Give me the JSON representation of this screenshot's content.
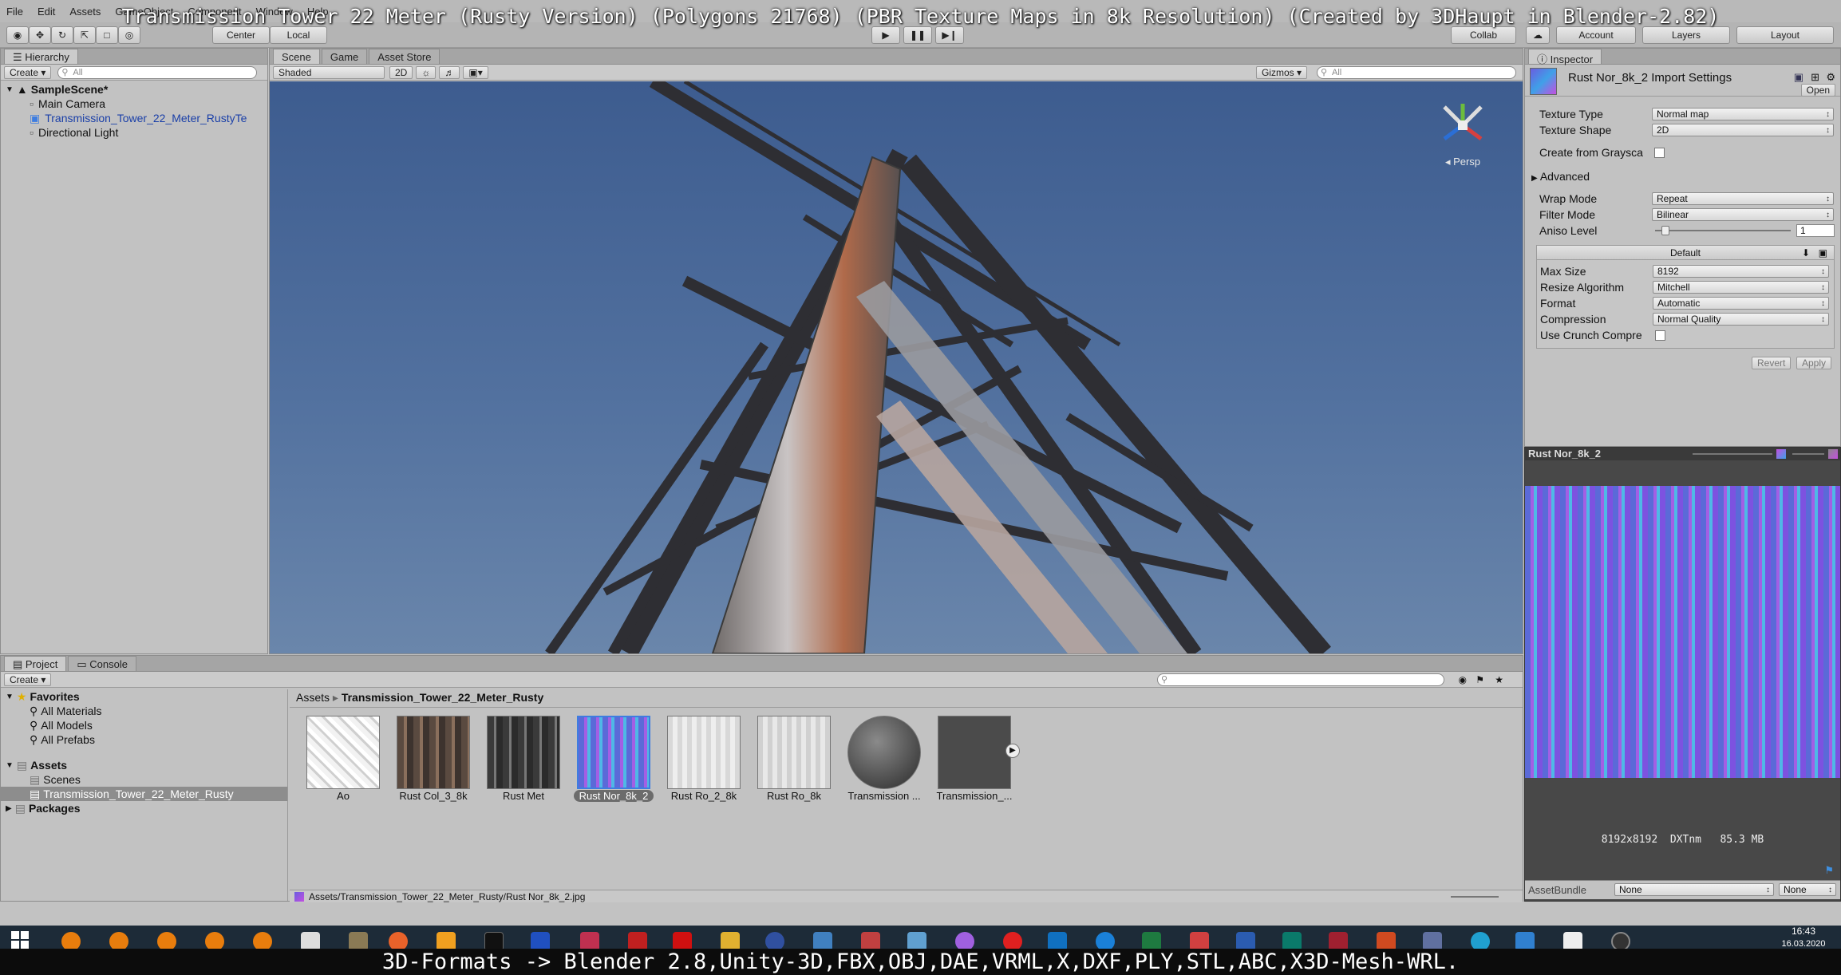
{
  "overlay_title": "Transmission Tower 22 Meter (Rusty Version) (Polygons 21768) (PBR Texture Maps in 8k Resolution) (Created by 3DHaupt in Blender-2.82)",
  "menu": [
    "File",
    "Edit",
    "Assets",
    "GameObject",
    "Component",
    "Window",
    "Help"
  ],
  "toolbar": {
    "center_label": "Center",
    "local_label": "Local",
    "collab_label": "Collab",
    "account_label": "Account",
    "layers_label": "Layers",
    "layout_label": "Layout"
  },
  "hierarchy": {
    "tab": "Hierarchy",
    "create": "Create",
    "search_placeholder": "All",
    "scene": "SampleScene*",
    "items": [
      "Main Camera",
      "Transmission_Tower_22_Meter_RustyTe",
      "Directional Light"
    ]
  },
  "scene_view": {
    "tabs": [
      "Scene",
      "Game",
      "Asset Store"
    ],
    "shading": "Shaded",
    "mode_2d": "2D",
    "gizmos": "Gizmos",
    "search_placeholder": "All",
    "persp_label": "Persp"
  },
  "inspector": {
    "tab": "Inspector",
    "title": "Rust Nor_8k_2 Import Settings",
    "open_button": "Open",
    "fields": {
      "texture_type": {
        "label": "Texture Type",
        "value": "Normal map"
      },
      "texture_shape": {
        "label": "Texture Shape",
        "value": "2D"
      },
      "create_from_grayscale": {
        "label": "Create from Graysca"
      },
      "advanced": {
        "label": "Advanced"
      },
      "wrap_mode": {
        "label": "Wrap Mode",
        "value": "Repeat"
      },
      "filter_mode": {
        "label": "Filter Mode",
        "value": "Bilinear"
      },
      "aniso_level": {
        "label": "Aniso Level",
        "value": "1"
      }
    },
    "platform_tab": "Default",
    "platform_fields": {
      "max_size": {
        "label": "Max Size",
        "value": "8192"
      },
      "resize_algorithm": {
        "label": "Resize Algorithm",
        "value": "Mitchell"
      },
      "format": {
        "label": "Format",
        "value": "Automatic"
      },
      "compression": {
        "label": "Compression",
        "value": "Normal Quality"
      },
      "use_crunch": {
        "label": "Use Crunch Compre"
      }
    },
    "revert_button": "Revert",
    "apply_button": "Apply",
    "preview_title": "Rust Nor_8k_2",
    "preview_info": "8192x8192  DXTnm   85.3 MB",
    "assetbundle_label": "AssetBundle",
    "assetbundle_value": "None",
    "assetbundle_variant": "None"
  },
  "project": {
    "tabs": [
      "Project",
      "Console"
    ],
    "create": "Create",
    "favorites_label": "Favorites",
    "favorites": [
      "All Materials",
      "All Models",
      "All Prefabs"
    ],
    "assets_label": "Assets",
    "assets_children": [
      "Scenes",
      "Transmission_Tower_22_Meter_Rusty"
    ],
    "packages_label": "Packages",
    "breadcrumb": [
      "Assets",
      "Transmission_Tower_22_Meter_Rusty"
    ],
    "thumbnails": [
      "Ao",
      "Rust Col_3_8k",
      "Rust Met",
      "Rust Nor_8k_2",
      "Rust Ro_2_8k",
      "Rust Ro_8k",
      "Transmission ...",
      "Transmission_..."
    ],
    "selected_path": "Assets/Transmission_Tower_22_Meter_Rusty/Rust Nor_8k_2.jpg"
  },
  "clock": {
    "time": "16:43",
    "date": "16.03.2020"
  },
  "bottom_caption": "3D-Formats -> Blender 2.8,Unity-3D,FBX,OBJ,DAE,VRML,X,DXF,PLY,STL,ABC,X3D-Mesh-WRL.",
  "colors": {
    "sky": "#4f6f9e",
    "selection": "#3e7de0",
    "taskbar": "#1d2b38"
  }
}
